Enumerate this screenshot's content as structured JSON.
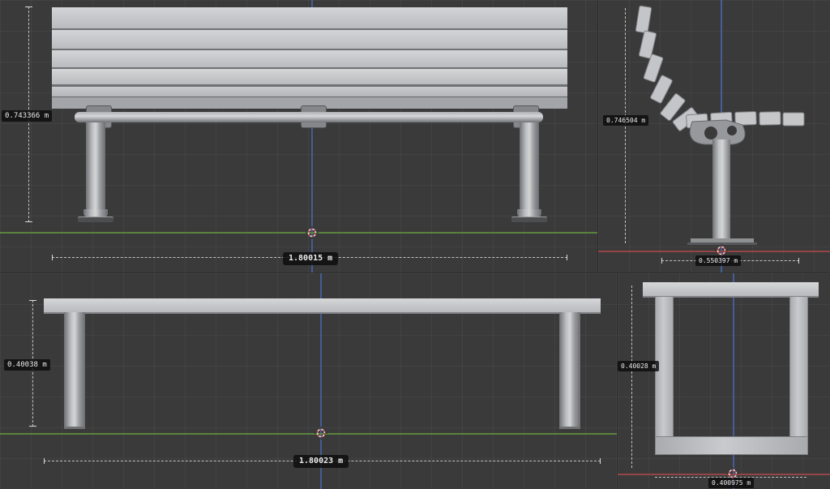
{
  "viewports": {
    "top_left": {
      "v_dim": "0.743366 m",
      "h_dim": "1.80015 m"
    },
    "top_right": {
      "v_dim": "0.746504 m",
      "h_dim": "0.550397 m"
    },
    "bottom_left": {
      "v_dim": "0.40038 m",
      "h_dim": "1.80023 m"
    },
    "bottom_right": {
      "v_dim": "0.40028 m",
      "h_dim": "0.400975 m"
    }
  },
  "colors": {
    "background": "#3a3a3b",
    "axis_z_blue": "#46629f",
    "axis_y_green": "#61913d",
    "axis_x_red": "#9e4848",
    "model_gray": "#c4c5c8"
  }
}
